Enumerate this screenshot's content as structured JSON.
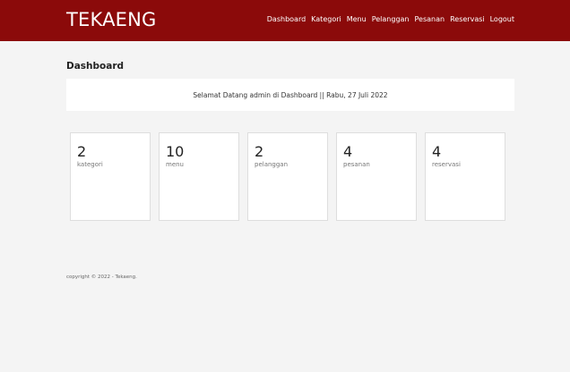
{
  "brand": "TEKAENG",
  "colors": {
    "navbar": "#8b0a0a",
    "page_background": "#f4f4f4",
    "card_background": "#ffffff"
  },
  "nav": [
    {
      "label": "Dashboard"
    },
    {
      "label": "Kategori"
    },
    {
      "label": "Menu"
    },
    {
      "label": "Pelanggan"
    },
    {
      "label": "Pesanan"
    },
    {
      "label": "Reservasi"
    },
    {
      "label": "Logout"
    }
  ],
  "page_title": "Dashboard",
  "welcome": "Selamat Datang admin di Dashboard || Rabu, 27 Juli 2022",
  "cards": [
    {
      "count": "2",
      "label": "kategori"
    },
    {
      "count": "10",
      "label": "menu"
    },
    {
      "count": "2",
      "label": "pelanggan"
    },
    {
      "count": "4",
      "label": "pesanan"
    },
    {
      "count": "4",
      "label": "reservasi"
    }
  ],
  "footer": "copyright © 2022 - Tekaeng."
}
